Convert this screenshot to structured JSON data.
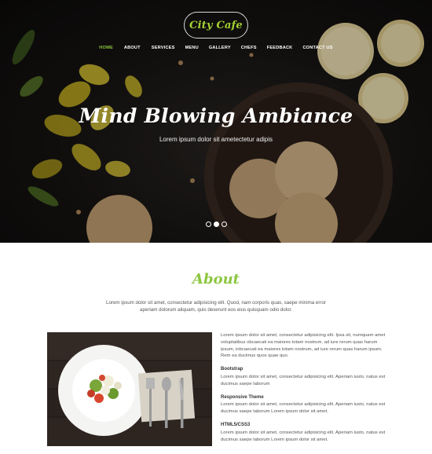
{
  "brand": {
    "logo_text": "City Cafe",
    "accent": "#8cc63f"
  },
  "nav": {
    "items": [
      {
        "label": "HOME",
        "active": true
      },
      {
        "label": "ABOUT"
      },
      {
        "label": "SERVICES"
      },
      {
        "label": "MENU"
      },
      {
        "label": "GALLERY"
      },
      {
        "label": "CHEFS"
      },
      {
        "label": "FEEDBACK"
      },
      {
        "label": "CONTACT US"
      }
    ]
  },
  "hero": {
    "title": "Mind Blowing Ambiance",
    "subtitle": "Lorem ipsum dolor sit ametectetur adipis",
    "slides": 3,
    "active_slide": 2
  },
  "about": {
    "title": "About",
    "lead": "Lorem ipsum dolor sit amet, consectetur adipisicing elit. Quod, nam corporis quas, saepe minima error aperiam dolorum aliquam, quis deserunt eos eius quisquam odio dolor.",
    "intro": "Lorem ipsum dolor sit amet, consectetur adipisicing elit. Ipsa sit, numquam amet voluptatibus obcaecati ea maiores totam nostrum, ad iure rerum quas harum ipsum, iobcaecati ea maiores totam nostrum, ad iure rerum quas harum ipsum. Rem ea ducimus quos quae quo.",
    "features": [
      {
        "heading": "Bootstrap",
        "text": "Lorem ipsum dolor sit amet, consectetur adipisicing elit. Aperiam iusto, natus est ducimus saepe laborum"
      },
      {
        "heading": "Responsive Theme",
        "text": "Lorem ipsum dolor sit amet, consectetur adipisicing elit. Aperiam iusto, natus est ducimus saepe laborum Lorem ipsum dolor sit amet."
      },
      {
        "heading": "HTML5/CSS3",
        "text": "Lorem ipsum dolor sit amet, consectetur adipisicing elit. Aperiam iusto, natus est ducimus saepe laborum Lorem ipsum dolor sit amet."
      }
    ]
  }
}
